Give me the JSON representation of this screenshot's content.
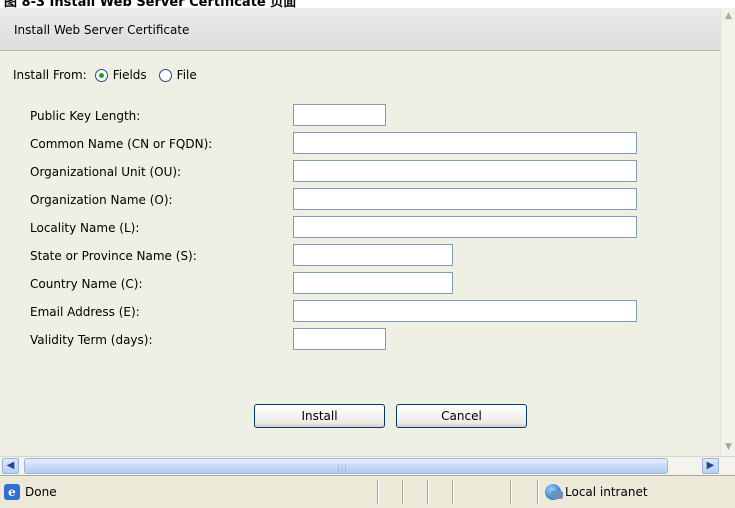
{
  "page_caption": "图 8-3 Install Web Server Certificate 页面",
  "panel": {
    "title": "Install Web Server Certificate"
  },
  "install_from": {
    "label": "Install From:",
    "options": [
      {
        "label": "Fields",
        "selected": true
      },
      {
        "label": "File",
        "selected": false
      }
    ]
  },
  "fields": [
    {
      "label": "Public Key Length:",
      "value": ""
    },
    {
      "label": "Common Name (CN or FQDN):",
      "value": ""
    },
    {
      "label": "Organizational Unit (OU):",
      "value": ""
    },
    {
      "label": "Organization Name (O):",
      "value": ""
    },
    {
      "label": "Locality Name (L):",
      "value": ""
    },
    {
      "label": "State or Province Name (S):",
      "value": ""
    },
    {
      "label": "Country Name (C):",
      "value": ""
    },
    {
      "label": "Email Address (E):",
      "value": ""
    },
    {
      "label": "Validity Term (days):",
      "value": ""
    }
  ],
  "buttons": {
    "install": "Install",
    "cancel": "Cancel"
  },
  "statusbar": {
    "status": "Done",
    "zone": "Local intranet"
  },
  "colors": {
    "panel_background": "#efefe3",
    "header_background": "#dcdcdc",
    "radio_selected": "#21a121",
    "input_border": "#7f9db9",
    "button_border": "#003c74"
  }
}
